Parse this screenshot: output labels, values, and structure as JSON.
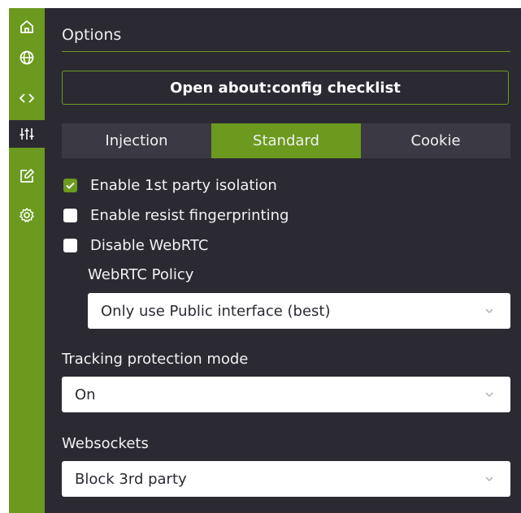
{
  "sidebar": {
    "items": [
      {
        "icon": "home-icon"
      },
      {
        "icon": "globe-icon"
      },
      {
        "icon": "code-icon"
      },
      {
        "icon": "sliders-icon",
        "active": true
      },
      {
        "icon": "edit-icon"
      },
      {
        "icon": "gear-icon"
      }
    ]
  },
  "options": {
    "title": "Options",
    "config_button": "Open about:config checklist",
    "tabs": [
      "Injection",
      "Standard",
      "Cookie"
    ],
    "active_tab": "Standard",
    "checkboxes": [
      {
        "label": "Enable 1st party isolation",
        "checked": true
      },
      {
        "label": "Enable resist fingerprinting",
        "checked": false
      },
      {
        "label": "Disable WebRTC",
        "checked": false
      }
    ],
    "webrtc_policy": {
      "label": "WebRTC Policy",
      "value": "Only use Public interface (best)"
    },
    "tracking_protection": {
      "label": "Tracking protection mode",
      "value": "On"
    },
    "websockets": {
      "label": "Websockets",
      "value": "Block 3rd party"
    }
  },
  "colors": {
    "accent": "#6b9a1f",
    "background": "#2b2a33",
    "tab_inactive": "#3b3a44"
  }
}
